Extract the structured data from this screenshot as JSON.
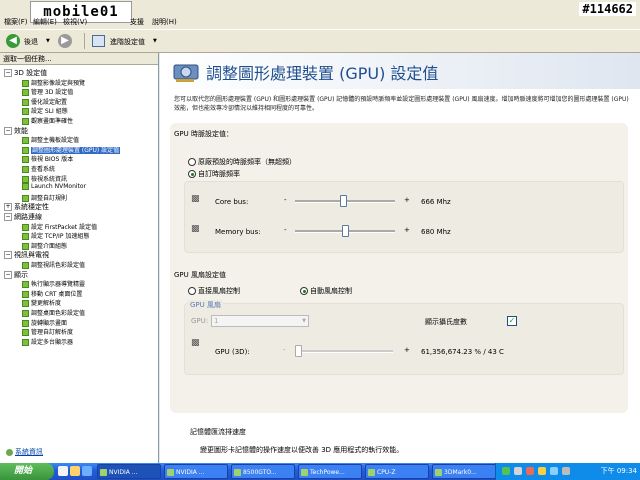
{
  "watermark": "#114662",
  "logo_text": "mobile01",
  "menu": {
    "items": [
      "檔案(F)",
      "編輯(E)",
      "檢視(V)",
      "",
      "支援",
      "說明(H)"
    ],
    "menu_highlight": "檔案(F)"
  },
  "toolbar": {
    "back_label": "後退",
    "adv_settings_label": "進階設定值"
  },
  "left_panel": {
    "header": "選取一個任務...",
    "tree": [
      {
        "type": "cat",
        "label": "3D 設定值",
        "expanded": true
      },
      {
        "type": "leaf",
        "label": "調整影像設定與預覽"
      },
      {
        "type": "leaf",
        "label": "管理 3D 設定值"
      },
      {
        "type": "leaf",
        "label": "優化設定配置"
      },
      {
        "type": "leaf",
        "label": "設定 SLI 組態"
      },
      {
        "type": "leaf",
        "label": "觀察畫面準確性"
      },
      {
        "type": "cat",
        "label": "效能",
        "expanded": true
      },
      {
        "type": "leaf",
        "label": "調整主機板設定值"
      },
      {
        "type": "leaf",
        "label": "調整圖形處理裝置 (GPU) 設定值",
        "selected": true
      },
      {
        "type": "leaf",
        "label": "檢視 BIOS 版本"
      },
      {
        "type": "leaf",
        "label": "查看系統"
      },
      {
        "type": "leaf",
        "label": "檢視系統資訊"
      },
      {
        "type": "leaf",
        "label": "Launch NVMonitor"
      },
      {
        "type": "leaf",
        "label": "調整自訂規則"
      },
      {
        "type": "cat",
        "label": "系統穩定性",
        "expanded": false
      },
      {
        "type": "cat",
        "label": "網路連線",
        "expanded": true
      },
      {
        "type": "leaf",
        "label": "設定 FirstPacket 設定值"
      },
      {
        "type": "leaf",
        "label": "設定 TCP/IP 加速組態"
      },
      {
        "type": "leaf",
        "label": "調整介面組態"
      },
      {
        "type": "cat",
        "label": "視訊與電視",
        "expanded": true
      },
      {
        "type": "leaf",
        "label": "調整視訊色彩設定值"
      },
      {
        "type": "cat",
        "label": "顯示",
        "expanded": true
      },
      {
        "type": "leaf",
        "label": "執行顯示器導覽精靈"
      },
      {
        "type": "leaf",
        "label": "移動 CRT 桌面位置"
      },
      {
        "type": "leaf",
        "label": "變更解析度"
      },
      {
        "type": "leaf",
        "label": "調整桌面色彩設定值"
      },
      {
        "type": "leaf",
        "label": "旋轉顯示畫面"
      },
      {
        "type": "leaf",
        "label": "管理自訂解析度"
      },
      {
        "type": "leaf",
        "label": "設定多台顯示器"
      }
    ],
    "system_info_link": "系統資訊"
  },
  "main": {
    "title": "調整圖形處理裝置 (GPU) 設定值",
    "description": "您可以取代您的圖形處理裝置 (GPU) 和圖形處理裝置 (GPU) 記憶體的預設時脈頻率並設定圖形處理裝置 (GPU) 風扇速度。增加時脈速度將可增加您的圖形處理裝置 (GPU) 效能，但也能效專冷卻情況以維持相同程度的可靠性。",
    "clock_section_title": "GPU 時脈設定值：",
    "radio_default": "原廠預設的時脈頻率（無超頻）",
    "radio_custom": "自訂時脈頻率",
    "core_label": "Core bus:",
    "core_value": "666 Mhz",
    "core_position": 0.48,
    "memory_label": "Memory bus:",
    "memory_value": "680 Mhz",
    "memory_position": 0.5,
    "fan_section_title": "GPU 風扇設定值",
    "radio_direct_fan": "直接風扇控制",
    "radio_auto_fan": "自動風扇控制",
    "fan_group_title": "GPU 風扇",
    "gpu_select_label": "GPU:",
    "gpu_select_value": "1",
    "show_celsius_label": "顯示攝氏度數",
    "gpu3d_label": "GPU (3D):",
    "gpu3d_value": "61,356,674.23 % / 43 C",
    "memory_bus_section_title": "記憶體匯流排速度",
    "memory_bus_desc": "變更圖形卡記憶體的操作速度以便改善 3D 應用程式的執行效能。"
  },
  "taskbar": {
    "start_label": "開始",
    "buttons": [
      "NVIDIA ...",
      "NVIDIA ...",
      "8500GTO...",
      "TechPowe...",
      "CPU-Z",
      "3DMark0..."
    ],
    "active_index": 0,
    "clock": "下午 09:34"
  },
  "colors": {
    "accent": "#316ac5",
    "title_blue": "#1f4f8f",
    "taskbar": "#245edb"
  }
}
